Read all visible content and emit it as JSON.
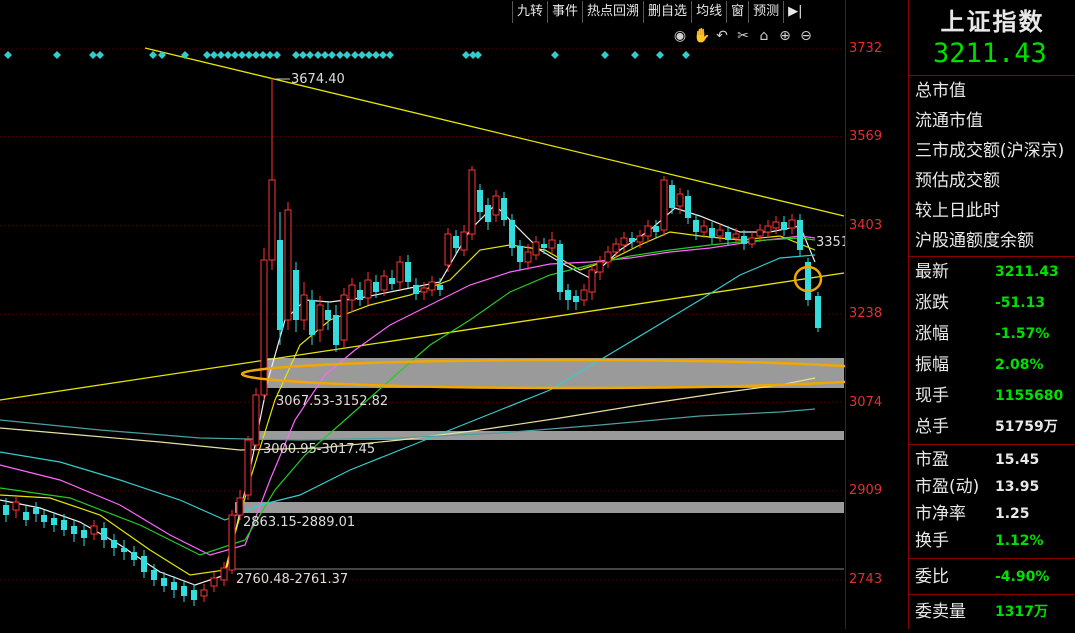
{
  "toolbar": {
    "buttons": [
      "九转",
      "事件",
      "热点回溯",
      "删自选",
      "均线",
      "窗",
      "预测"
    ],
    "collapse_icon": "collapse-right-icon"
  },
  "chart_tools": [
    "eye-icon",
    "hand-icon",
    "undo-icon",
    "scissors-icon",
    "lock-icon",
    "zoom-in-icon",
    "zoom-out-icon"
  ],
  "price_axis": {
    "ticks": [
      "3732",
      "3569",
      "3403",
      "3238",
      "3074",
      "2909",
      "2743"
    ]
  },
  "chart_data": {
    "type": "candlestick",
    "title": "",
    "ylim": [
      2680,
      3760
    ],
    "y_ticks": [
      3732,
      3569,
      3403,
      3238,
      3074,
      2909,
      2743
    ],
    "annotations": {
      "high_label": "3674.40",
      "right_label": "3351",
      "gap_zones": [
        "3067.53-3152.82",
        "3000.95-3017.45",
        "2863.15-2889.01",
        "2760.48-2761.37"
      ]
    }
  },
  "quote_panel": {
    "index_name": "上证指数",
    "price": "3211.43",
    "fields_top": [
      "总市值",
      "流通市值",
      "三市成交额(沪深京)",
      "预估成交额",
      "较上日此时",
      "沪股通额度余额"
    ],
    "quotes": [
      {
        "label": "最新",
        "value": "3211.43"
      },
      {
        "label": "涨跌",
        "value": "-51.13"
      },
      {
        "label": "涨幅",
        "value": "-1.57%"
      },
      {
        "label": "振幅",
        "value": "2.08%"
      },
      {
        "label": "现手",
        "value": "1155680"
      },
      {
        "label": "总手",
        "value": "51759万"
      }
    ],
    "ratios": [
      {
        "label": "市盈",
        "value": "15.45"
      },
      {
        "label": "市盈(动)",
        "value": "13.95"
      },
      {
        "label": "市净率",
        "value": "1.25"
      },
      {
        "label": "换手",
        "value": "1.12%"
      }
    ],
    "bottom": [
      {
        "label": "委比",
        "value": "-4.90%"
      },
      {
        "label": "委卖量",
        "value": "1317万"
      }
    ]
  }
}
